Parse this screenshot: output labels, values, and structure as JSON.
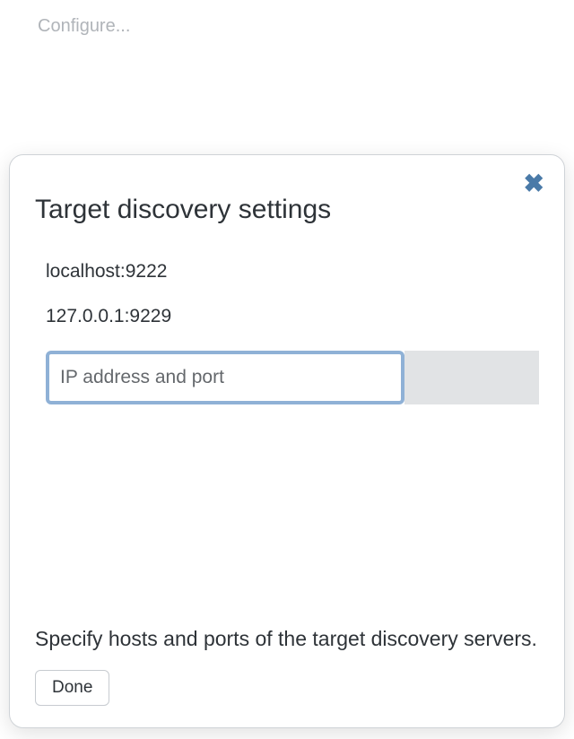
{
  "page": {
    "configure_link": "Configure..."
  },
  "modal": {
    "title": "Target discovery settings",
    "targets": [
      "localhost:9222",
      "127.0.0.1:9229"
    ],
    "input": {
      "placeholder": "IP address and port",
      "value": ""
    },
    "help_text": "Specify hosts and ports of the target discovery servers.",
    "done_label": "Done"
  }
}
